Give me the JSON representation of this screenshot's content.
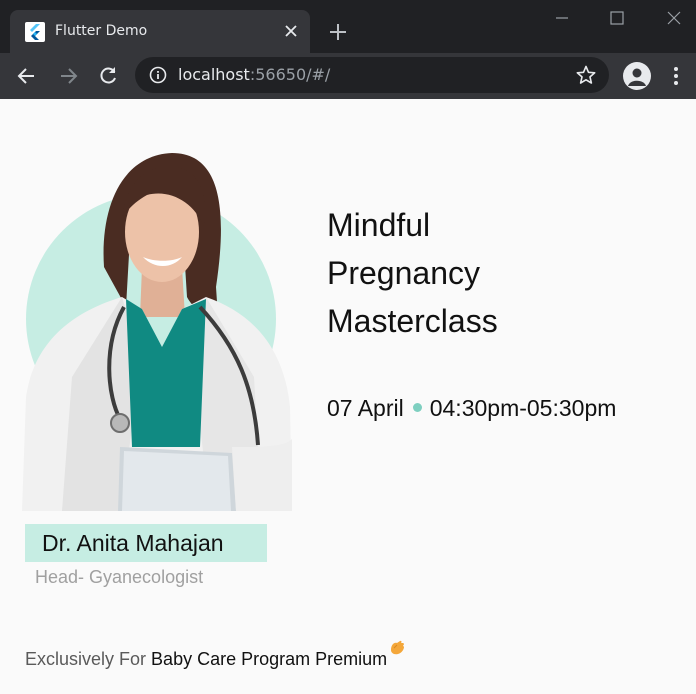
{
  "browser": {
    "tab_title": "Flutter Demo",
    "url_host": "localhost",
    "url_rest": ":56650/#/",
    "icons": {
      "favicon": "flutter-icon",
      "tab_close": "close-icon",
      "new_tab": "plus-icon",
      "back": "arrow-left-icon",
      "forward": "arrow-right-icon",
      "reload": "reload-icon",
      "site_info": "info-icon",
      "bookmark": "star-icon",
      "profile": "account-icon",
      "menu": "kebab-menu-icon"
    }
  },
  "doctor": {
    "name": "Dr. Anita Mahajan",
    "role": "Head- Gyanecologist"
  },
  "event": {
    "title_lines": [
      "Mindful",
      "Pregnancy",
      "Masterclass"
    ],
    "date": "07 April",
    "time": "04:30pm-05:30pm"
  },
  "footer": {
    "prefix": "Exclusively For",
    "program": "Baby Care Program Premium"
  },
  "colors": {
    "accent_mint": "#c6ede3",
    "dot_teal": "#7ecfc0",
    "chrome_dark": "#202124",
    "chrome_toolbar": "#35363a"
  }
}
